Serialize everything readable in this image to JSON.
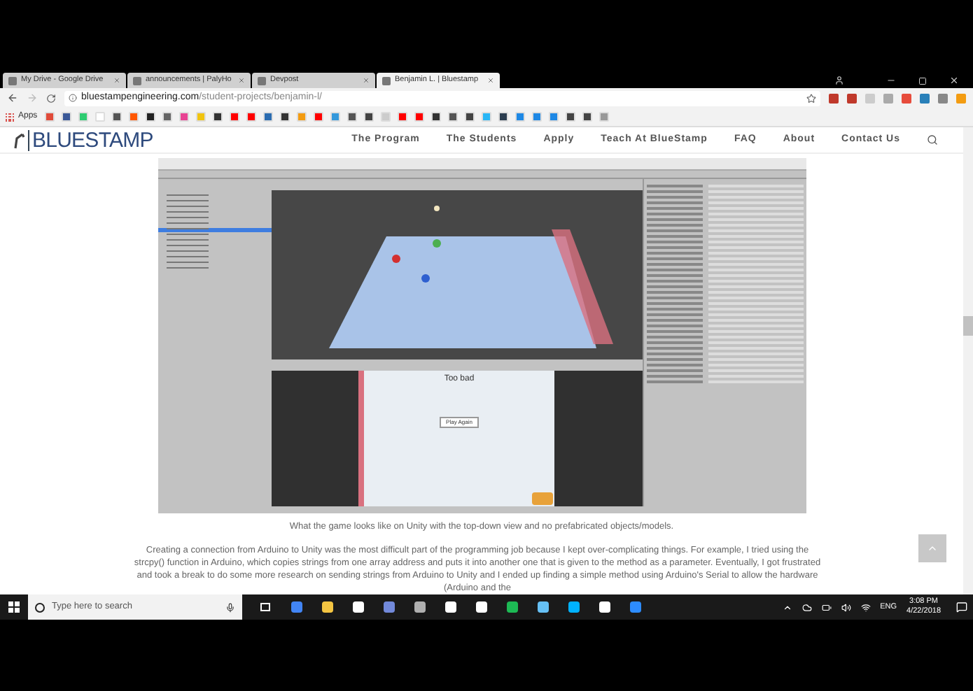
{
  "browser": {
    "tabs": [
      {
        "title": "My Drive - Google Drive",
        "selected": false
      },
      {
        "title": "announcements | PalyHo",
        "selected": false
      },
      {
        "title": "Devpost",
        "selected": false
      },
      {
        "title": "Benjamin L. | Bluestamp",
        "selected": true
      }
    ],
    "address": {
      "host": "bluestampengineering.com",
      "path": "/student-projects/benjamin-l/"
    },
    "bookmarks_label": "Apps"
  },
  "site": {
    "logo": "BLUESTAMP",
    "nav": [
      "The Program",
      "The Students",
      "Apply",
      "Teach At BlueStamp",
      "FAQ",
      "About",
      "Contact Us"
    ]
  },
  "article": {
    "figure": {
      "game_text": "Too bad",
      "game_button": "Play Again",
      "caption": "What the game looks like on Unity with the top-down view and no prefabricated objects/models."
    },
    "paragraph": "Creating a connection from Arduino to Unity was the most difficult part of the programming job because I kept over-complicating things. For example, I tried using the strcpy() function in Arduino, which copies strings from one array address and puts it into another one that is given to the method as a parameter. Eventually, I got frustrated and took a break to do some more research on sending strings from Arduino to Unity and I ended up finding a simple method using Arduino's Serial to allow the hardware (Arduino and the"
  },
  "taskbar": {
    "search_placeholder": "Type here to search",
    "language": "ENG",
    "time": "3:08 PM",
    "date": "4/22/2018"
  }
}
